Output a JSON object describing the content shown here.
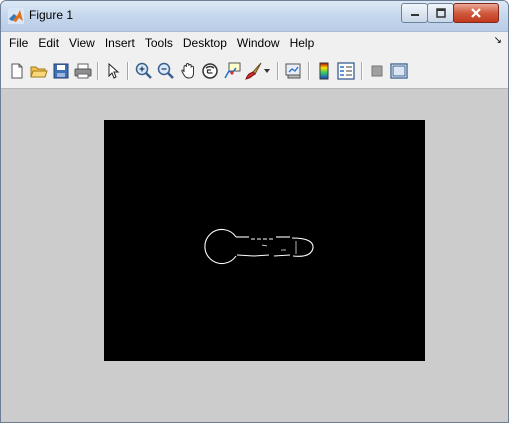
{
  "window": {
    "title": "Figure 1",
    "accent": "#b9cde6",
    "figure_background": "#cccccc",
    "axes_background": "#000000"
  },
  "title_buttons": {
    "minimize": "minimize-icon",
    "maximize": "maximize-icon",
    "close": "close-icon"
  },
  "menu": {
    "items": [
      "File",
      "Edit",
      "View",
      "Insert",
      "Tools",
      "Desktop",
      "Window",
      "Help"
    ]
  },
  "toolbar": {
    "buttons": [
      "new-figure-icon",
      "open-file-icon",
      "save-icon",
      "print-icon",
      "edit-plot-icon",
      "zoom-in-icon",
      "zoom-out-icon",
      "pan-icon",
      "rotate-3d-icon",
      "data-cursor-icon",
      "brush-icon",
      "brush-dropdown-icon",
      "link-plot-icon",
      "insert-colorbar-icon",
      "insert-legend-icon",
      "hide-plot-tools-icon",
      "show-plot-tools-icon"
    ]
  }
}
